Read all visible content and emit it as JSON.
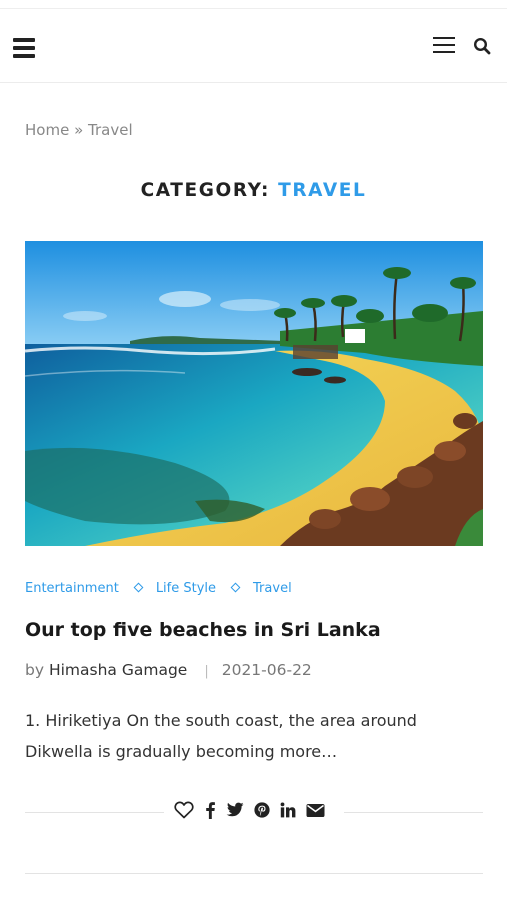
{
  "header": {
    "left_icon": "hamburger-menu-icon",
    "right_icons": [
      "hamburger-menu-icon",
      "search-icon"
    ]
  },
  "breadcrumb": {
    "home": "Home",
    "separator": "»",
    "current": "Travel"
  },
  "page_title": {
    "prefix": "CATEGORY: ",
    "category": "TRAVEL"
  },
  "post": {
    "image_alt": "Tropical beach with palm trees, turquoise water and dark rocks",
    "categories": [
      "Entertainment",
      "Life Style",
      "Travel"
    ],
    "title": "Our top five beaches in Sri Lanka",
    "author_prefix": "by",
    "author": "Himasha Gamage",
    "meta_divider": "|",
    "date": "2021-06-22",
    "excerpt": "1. Hiriketiya On the south coast, the area around Dikwella is gradually becoming more…",
    "share_icons": [
      "heart-icon",
      "facebook-icon",
      "twitter-icon",
      "pinterest-icon",
      "linkedin-icon",
      "email-icon"
    ]
  },
  "colors": {
    "accent": "#2f9be8",
    "text": "#222222",
    "muted": "#888888"
  }
}
